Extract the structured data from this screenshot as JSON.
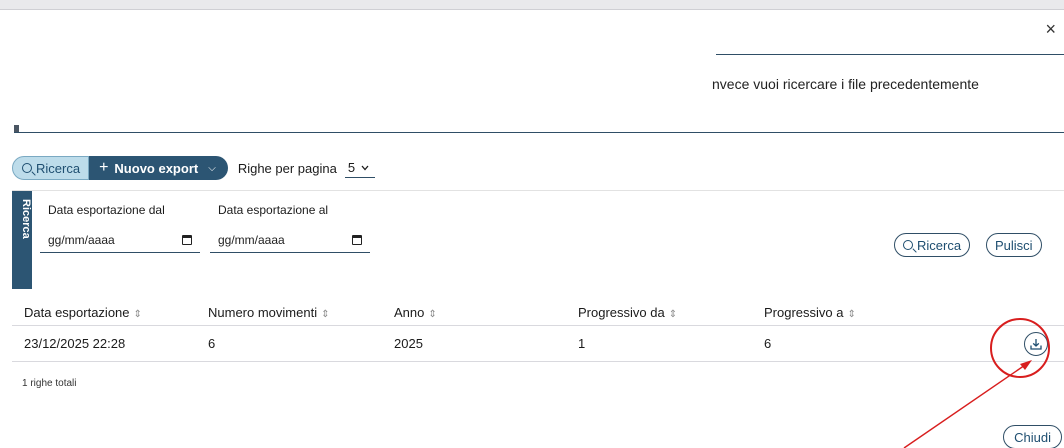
{
  "dialog": {
    "close_glyph": "×",
    "intro_text": "nvece vuoi ricercare i file precedentemente"
  },
  "toolbar": {
    "ricerca_label": "Ricerca",
    "nuovo_export_label": "Nuovo export",
    "rows_per_page_label": "Righe per pagina",
    "rows_per_page_value": "5"
  },
  "search_panel": {
    "side_tab_label": "Ricerca",
    "date_from": {
      "label": "Data esportazione dal",
      "placeholder": "gg/mm/aaaa"
    },
    "date_to": {
      "label": "Data esportazione al",
      "placeholder": "gg/mm/aaaa"
    },
    "search_button": "Ricerca",
    "clear_button": "Pulisci"
  },
  "table": {
    "columns": [
      "Data esportazione",
      "Numero movimenti",
      "Anno",
      "Progressivo da",
      "Progressivo a"
    ],
    "sort_glyph": "⇕",
    "rows": [
      [
        "23/12/2025 22:28",
        "6",
        "2025",
        "1",
        "6"
      ]
    ],
    "totals": "1 righe totali"
  },
  "footer": {
    "close_button": "Chiudi"
  },
  "colors": {
    "accent_dark": "#2c5573",
    "accent_light": "#bddcea",
    "annotation_red": "#d81e1e"
  }
}
